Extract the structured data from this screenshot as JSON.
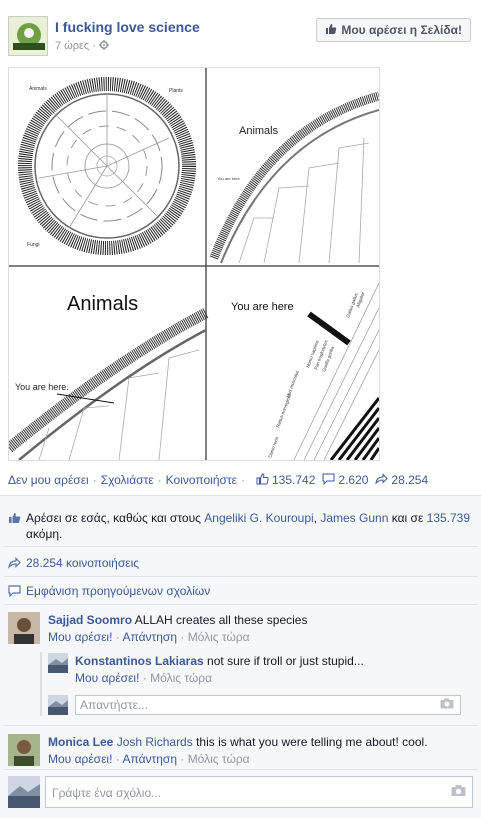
{
  "post": {
    "page_name": "I fucking love science",
    "time": "7 ώρες",
    "like_page_label": "Μου αρέσει η Σελίδα!",
    "image": {
      "labels": {
        "animals_large": "Animals",
        "animals_medium": "Animals",
        "animals_small": "Animals",
        "you_are_here_1": "You are here",
        "you_are_here_2": "You are here.",
        "you_are_here_3": "You are here",
        "plants": "Plants",
        "fungi": "Fungi"
      }
    }
  },
  "actions": {
    "unlike": "Δεν μου αρέσει",
    "comment": "Σχολιάστε",
    "share": "Κοινοποιήστε",
    "likes_count": "135.742",
    "comments_count": "2.620",
    "shares_count": "28.254"
  },
  "likes_summary": {
    "prefix": "Αρέσει σε εσάς, καθώς και στους",
    "friend1": "Angeliki G. Kouroupi",
    "friend2": "James Gunn",
    "middle": "και σε",
    "others": "135.739",
    "suffix": "ακόμη."
  },
  "shares_summary": "28.254 κοινοποιήσεις",
  "show_previous": "Εμφάνιση προηγούμενων σχολίων",
  "comments": [
    {
      "author": "Sajjad Soomro",
      "text": "ALLAH creates all these species",
      "like": "Μου αρέσει!",
      "reply": "Απάντηση",
      "time": "Μόλις τώρα"
    },
    {
      "author": "Monica Lee",
      "tag": "Josh Richards",
      "text": "this is what you were telling me about! cool.",
      "like": "Μου αρέσει!",
      "reply": "Απάντηση",
      "time": "Μόλις τώρα"
    }
  ],
  "reply": {
    "author": "Konstantinos Lakiaras",
    "text": "not sure if troll or just stupid...",
    "like": "Μου αρέσει!",
    "time": "Μόλις τώρα"
  },
  "reply_input": {
    "placeholder": "Απαντήστε..."
  },
  "comment_input": {
    "placeholder": "Γράψτε ένα σχόλιο..."
  },
  "icons": [
    "thumbs-up-icon",
    "gear-icon",
    "comment-icon",
    "share-icon",
    "camera-icon"
  ]
}
